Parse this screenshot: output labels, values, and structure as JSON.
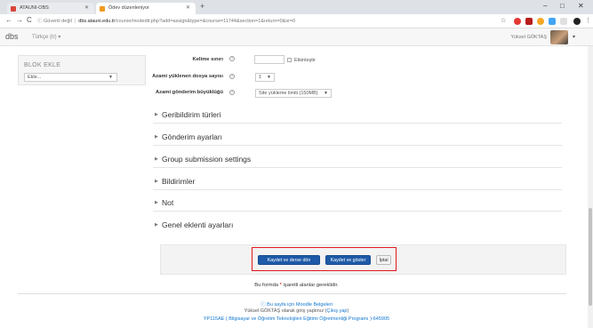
{
  "browser": {
    "tabs": [
      {
        "label": "ATAUNI-OBS",
        "active": false
      },
      {
        "label": "Ödev düzenleniyor",
        "active": true
      }
    ],
    "new_tab": "+",
    "win_min": "–",
    "win_max": "□",
    "win_close": "✕",
    "security": "Güvenli değil",
    "host": "dbs.atauni.edu.tr",
    "path": "/course/modedit.php?add=assign&type=&course=11744&section=1&return=0&sr=0"
  },
  "navbar": {
    "brand": "dbs",
    "language": "Türkçe (tr) ▾",
    "user_name": "Yüksel GÖKTAŞ"
  },
  "block": {
    "title": "BLOK EKLE",
    "select_value": "Ekle..."
  },
  "form": {
    "word_limit": {
      "label": "Kelime sınırı",
      "value": "",
      "checkbox_label": "Etkinleştir"
    },
    "max_files": {
      "label": "Azami yüklenen dosya sayısı",
      "value": "1"
    },
    "max_size": {
      "label": "Azami gönderim büyüklüğü",
      "value": "Site yükleme limiti (150MB)"
    }
  },
  "sections": [
    {
      "label": "Geribildirim türleri"
    },
    {
      "label": "Gönderim ayarları"
    },
    {
      "label": "Group submission settings"
    },
    {
      "label": "Bildirimler"
    },
    {
      "label": "Not"
    },
    {
      "label": "Genel eklenti ayarları"
    }
  ],
  "buttons": {
    "save_return": "Kaydet ve derse dön",
    "save_display": "Kaydet ve göster",
    "cancel": "İptal"
  },
  "required_note": {
    "before": "Bu formda ",
    "star": "*",
    "after": " işaretli alanlar gereklidir."
  },
  "footer": {
    "docs_link": "ⓘ Bu sayfa için Moodle Belgeleri",
    "logged_in_prefix": "Yüksel GÖKTAŞ olarak giriş yaptınız (",
    "logout": "Çıkış yap",
    "logged_in_suffix": ")",
    "course": "YP115AE ( Bilgisayar ve Öğretim Teknolojileri Eğitimi Öğretmenliği Programı )-645905"
  },
  "colors": {
    "primary_button": "#1e5aa8",
    "highlight": "#e0181f",
    "link": "#1177d1"
  }
}
